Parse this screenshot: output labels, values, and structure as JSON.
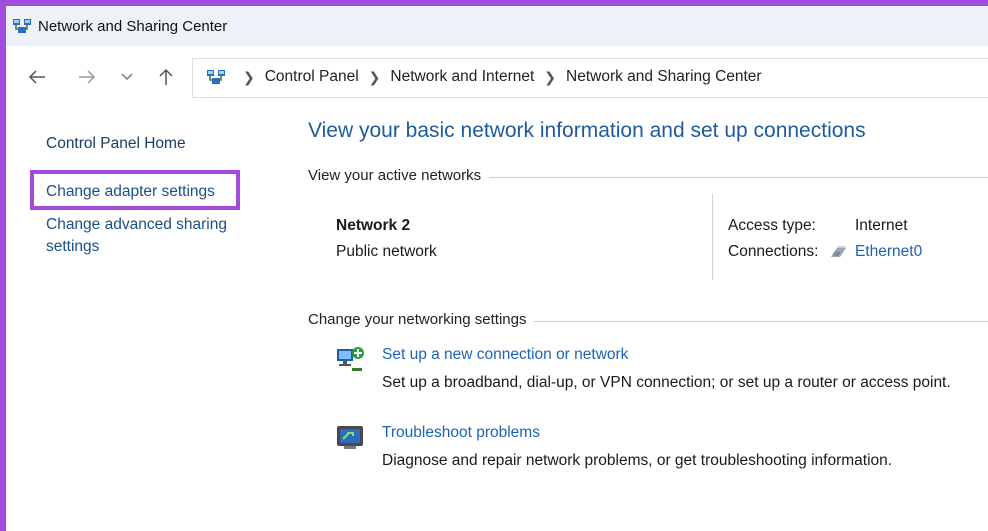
{
  "window": {
    "title": "Network and Sharing Center"
  },
  "nav": {
    "back_icon": "arrow-left-icon",
    "forward_icon": "arrow-right-icon",
    "recent_icon": "chevron-down-icon",
    "up_icon": "arrow-up-icon"
  },
  "breadcrumb": [
    "Control Panel",
    "Network and Internet",
    "Network and Sharing Center"
  ],
  "sidebar": {
    "home": "Control Panel Home",
    "adapter": "Change adapter settings",
    "advanced_line1": "Change advanced sharing",
    "advanced_line2": "settings"
  },
  "main": {
    "heading": "View your basic network information and set up connections",
    "active_label": "View your active networks",
    "network": {
      "name": "Network 2",
      "type": "Public network",
      "access_type_label": "Access type:",
      "access_type_value": "Internet",
      "connections_label": "Connections:",
      "connections_value": "Ethernet0"
    },
    "change_label": "Change your networking settings",
    "tasks": [
      {
        "title": "Set up a new connection or network",
        "desc": "Set up a broadband, dial-up, or VPN connection; or set up a router or access point.",
        "icon": "new-connection-icon"
      },
      {
        "title": "Troubleshoot problems",
        "desc": "Diagnose and repair network problems, or get troubleshooting information.",
        "icon": "troubleshoot-icon"
      }
    ]
  },
  "colors": {
    "highlight": "#a34bdc",
    "link": "#1d63b8",
    "heading": "#1d5b9d"
  }
}
